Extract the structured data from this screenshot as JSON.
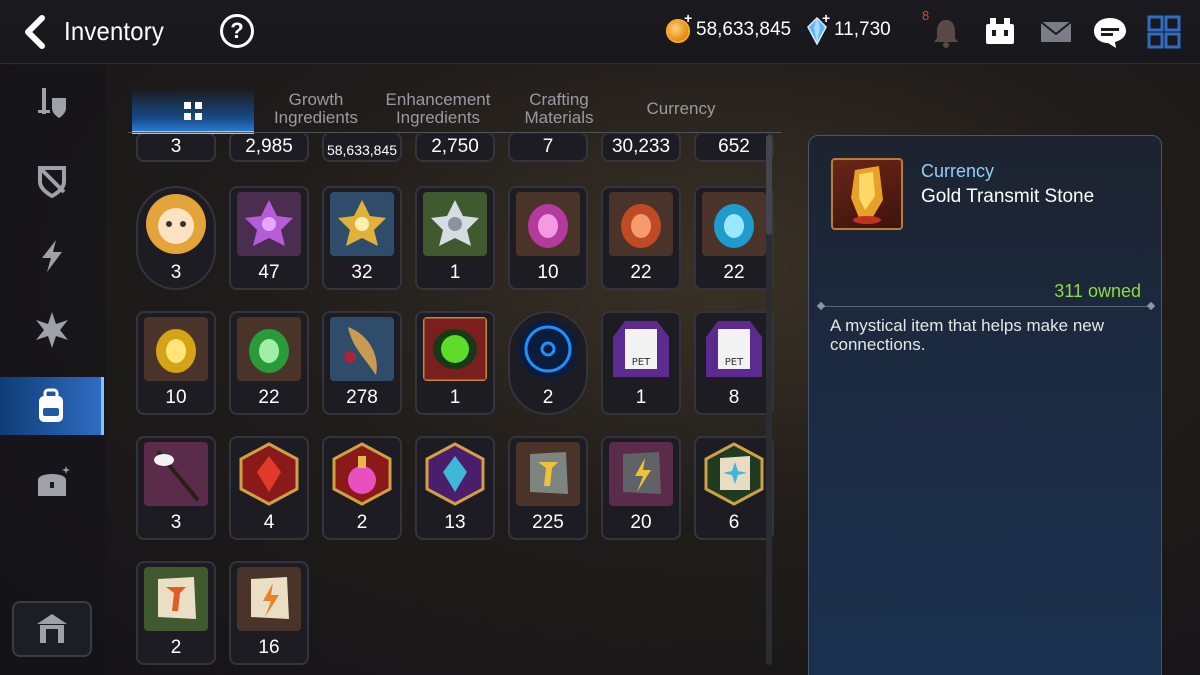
{
  "header": {
    "title": "Inventory",
    "help_label": "?",
    "gold_value": "58,633,845",
    "gem_value": "11,730",
    "notification_count": "8",
    "plus": "+"
  },
  "sidebar": {
    "items": [
      "equipment-icon",
      "artifact-icon",
      "catalyst-icon",
      "rune-icon",
      "items-bag-icon",
      "chest-icon"
    ],
    "active_index": 4,
    "bottom": "storage-icon"
  },
  "tabs": [
    {
      "label": "",
      "icon": "grid-icon",
      "active": true
    },
    {
      "label_lines": [
        "Growth",
        "Ingredients"
      ]
    },
    {
      "label_lines": [
        "Enhancement",
        "Ingredients"
      ]
    },
    {
      "label_lines": [
        "Crafting",
        "Materials"
      ]
    },
    {
      "label_lines": [
        "Currency"
      ]
    }
  ],
  "grid": {
    "top_row_counts": [
      "3",
      "2,985",
      "58,633,845",
      "2,750",
      "7",
      "30,233",
      "652"
    ],
    "rows": [
      [
        "3",
        "47",
        "32",
        "1",
        "10",
        "22",
        "22"
      ],
      [
        "10",
        "22",
        "278",
        "1",
        "2",
        "1",
        "8"
      ],
      [
        "3",
        "4",
        "2",
        "13",
        "225",
        "20",
        "6"
      ],
      [
        "2",
        "16"
      ]
    ],
    "pet_label": "PET"
  },
  "detail": {
    "category": "Currency",
    "name": "Gold Transmit Stone",
    "owned": "311 owned",
    "description": "A mystical item that helps make new connections."
  },
  "colors": {
    "accent": "#2a78d0",
    "owned_green": "#8fdc3c",
    "category_blue": "#8fd0ff"
  }
}
